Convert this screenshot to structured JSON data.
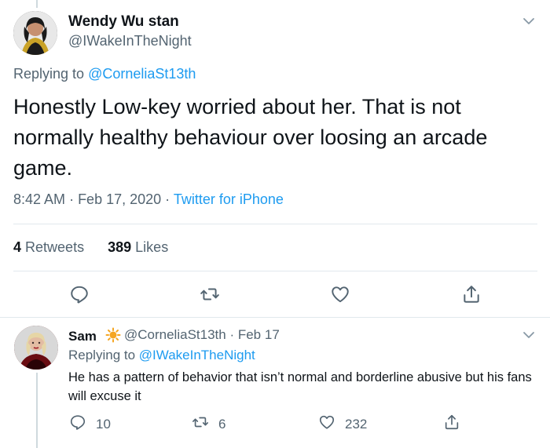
{
  "main_tweet": {
    "author_name": "Wendy Wu stan",
    "author_handle": "@IWakeInTheNight",
    "replying_prefix": "Replying to",
    "replying_to": "@CorneliaSt13th",
    "text": "Honestly Low-key worried about her. That is not normally healthy behaviour over loosing an arcade game.",
    "time": "8:42 AM",
    "date": "Feb 17, 2020",
    "source": "Twitter for iPhone",
    "retweet_count": "4",
    "retweet_label": "Retweets",
    "like_count": "389",
    "like_label": "Likes",
    "icons": [
      "reply-icon",
      "retweet-icon",
      "like-icon",
      "share-icon",
      "chevron-down-icon"
    ]
  },
  "reply_tweet": {
    "author_name": "Sam",
    "author_badge": "sun-emoji",
    "author_handle": "@CorneliaSt13th",
    "date": "Feb 17",
    "replying_prefix": "Replying to",
    "replying_to": "@IWakeInTheNight",
    "text": "He has a pattern of behavior that isn’t normal and borderline abusive but his fans will excuse it",
    "reply_count": "10",
    "retweet_count": "6",
    "like_count": "232"
  },
  "colors": {
    "link": "#1d9bf0",
    "secondary": "#536471",
    "primary": "#0f1419",
    "divider": "#e1e8ed"
  }
}
